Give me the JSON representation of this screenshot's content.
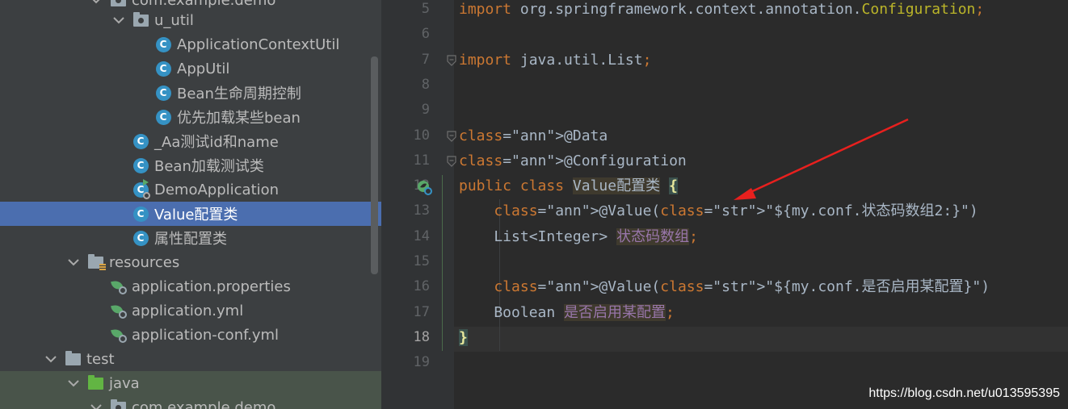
{
  "tree": {
    "rows": [
      {
        "label": "com.example.demo",
        "icon": "package-icon",
        "depth": 2,
        "expanded": true
      },
      {
        "label": "u_util",
        "icon": "package-icon",
        "depth": 3,
        "expanded": true
      },
      {
        "label": "ApplicationContextUtil",
        "icon": "class-icon",
        "depth": 4
      },
      {
        "label": "AppUtil",
        "icon": "class-icon",
        "depth": 4
      },
      {
        "label": "Bean生命周期控制",
        "icon": "class-icon",
        "depth": 4
      },
      {
        "label": "优先加载某些bean",
        "icon": "class-icon",
        "depth": 4
      },
      {
        "label": "_Aa测试id和name",
        "icon": "class-icon",
        "depth": 3
      },
      {
        "label": "Bean加载测试类",
        "icon": "class-icon",
        "depth": 3
      },
      {
        "label": "DemoApplication",
        "icon": "spring-boot-class-icon",
        "depth": 3
      },
      {
        "label": "Value配置类",
        "icon": "class-icon",
        "depth": 3,
        "selected": true
      },
      {
        "label": "属性配置类",
        "icon": "class-icon",
        "depth": 3
      },
      {
        "label": "resources",
        "icon": "resources-folder-icon",
        "depth": 1,
        "expanded": true
      },
      {
        "label": "application.properties",
        "icon": "spring-config-icon",
        "depth": 2
      },
      {
        "label": "application.yml",
        "icon": "spring-config-icon",
        "depth": 2
      },
      {
        "label": "application-conf.yml",
        "icon": "spring-config-icon",
        "depth": 2
      },
      {
        "label": "test",
        "icon": "folder-icon",
        "depth": 0,
        "expanded": true
      },
      {
        "label": "java",
        "icon": "test-folder-icon",
        "depth": 1,
        "expanded": true
      },
      {
        "label": "com.example.demo",
        "icon": "package-icon",
        "depth": 2,
        "expanded": true
      }
    ]
  },
  "editor": {
    "lines": [
      {
        "num": "5",
        "code": "import org.springframework.context.annotation.Configuration;"
      },
      {
        "num": "6",
        "code": ""
      },
      {
        "num": "7",
        "code": "import java.util.List;"
      },
      {
        "num": "8",
        "code": ""
      },
      {
        "num": "9",
        "code": ""
      },
      {
        "num": "10",
        "code": "@Data"
      },
      {
        "num": "11",
        "code": "@Configuration"
      },
      {
        "num": "12",
        "code": "public class Value配置类 {"
      },
      {
        "num": "13",
        "code": "    @Value(\"${my.conf.状态码数组2:}\")"
      },
      {
        "num": "14",
        "code": "    List<Integer> 状态码数组;"
      },
      {
        "num": "15",
        "code": ""
      },
      {
        "num": "16",
        "code": "    @Value(\"${my.conf.是否启用某配置}\")"
      },
      {
        "num": "17",
        "code": "    Boolean 是否启用某配置;"
      },
      {
        "num": "18",
        "code": "}"
      },
      {
        "num": "19",
        "code": ""
      }
    ],
    "current_line": "18"
  },
  "colors": {
    "keyword": "#cc7832",
    "annotation": "#bbb529",
    "string": "#6a8759",
    "selection": "#4b6eaf",
    "arrow": "#e8201e"
  },
  "watermark": "https://blog.csdn.net/u013595395"
}
